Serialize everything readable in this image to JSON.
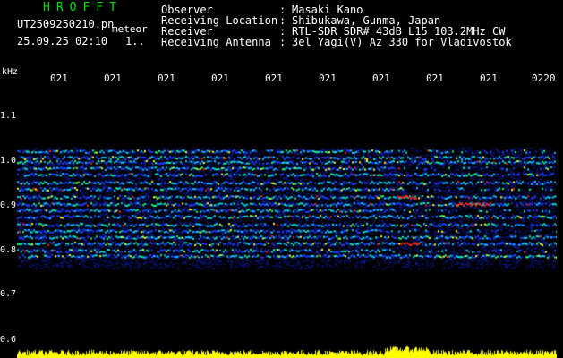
{
  "header": {
    "app_title": "HROFFT",
    "filename": "UT2509250210.pn",
    "filename_suffix": "meteor",
    "datetime": "25.09.25 02:10",
    "page_marker": "1..",
    "rows": [
      {
        "label": "Observer",
        "sep": ":",
        "value": "Masaki Kano"
      },
      {
        "label": "Receiving Location",
        "sep": ":",
        "value": "Shibukawa, Gunma, Japan"
      },
      {
        "label": "Receiver",
        "sep": ":",
        "value": "RTL-SDR SDR# 43dB L15 103.2MHz CW"
      },
      {
        "label": "Receiving Antenna",
        "sep": ":",
        "value": "3el Yagi(V) Az 330 for Vladivostok"
      }
    ]
  },
  "axis": {
    "unit": "kHz",
    "y_ticks": [
      "1.1",
      "1.0",
      "0.9",
      "0.8",
      "0.7",
      "0.6"
    ],
    "x_ticks": [
      "021",
      "021",
      "021",
      "021",
      "021",
      "021",
      "021",
      "021",
      "021",
      "0220"
    ]
  },
  "spectrogram": {
    "background": "#000000",
    "signal_colors": [
      "#0a1aa0",
      "#1f3dff",
      "#00c8ff",
      "#00ff80",
      "#ffff00",
      "#ff2000"
    ],
    "bottom_trace_color": "#ffff00"
  }
}
